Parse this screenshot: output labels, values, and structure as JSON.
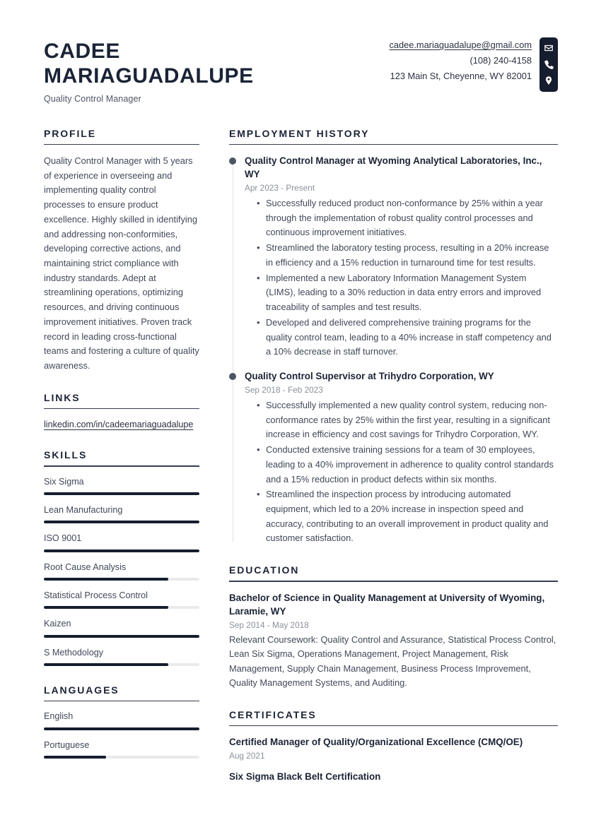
{
  "header": {
    "name_line_1": "CADEE",
    "name_line_2": "MARIAGUADALUPE",
    "job_title": "Quality Control Manager",
    "contact": {
      "email": "cadee.mariaguadalupe@gmail.com",
      "phone": "(108) 240-4158",
      "address": "123 Main St, Cheyenne, WY 82001",
      "icons": [
        "envelope-icon",
        "phone-icon",
        "location-pin-icon"
      ]
    }
  },
  "sections": {
    "profile": {
      "title": "PROFILE",
      "text": "Quality Control Manager with 5 years of experience in overseeing and implementing quality control processes to ensure product excellence. Highly skilled in identifying and addressing non-conformities, developing corrective actions, and maintaining strict compliance with industry standards. Adept at streamlining operations, optimizing resources, and driving continuous improvement initiatives. Proven track record in leading cross-functional teams and fostering a culture of quality awareness."
    },
    "links": {
      "title": "LINKS",
      "items": [
        {
          "label": "linkedin.com/in/cadeemariaguadalupe"
        }
      ]
    },
    "skills": {
      "title": "SKILLS",
      "items": [
        {
          "label": "Six Sigma",
          "level": 100
        },
        {
          "label": "Lean Manufacturing",
          "level": 100
        },
        {
          "label": "ISO 9001",
          "level": 100
        },
        {
          "label": "Root Cause Analysis",
          "level": 80
        },
        {
          "label": "Statistical Process Control",
          "level": 80
        },
        {
          "label": "Kaizen",
          "level": 100
        },
        {
          "label": "S Methodology",
          "level": 80
        }
      ]
    },
    "languages": {
      "title": "LANGUAGES",
      "items": [
        {
          "label": "English",
          "level": 100
        },
        {
          "label": "Portuguese",
          "level": 40
        }
      ]
    },
    "employment": {
      "title": "EMPLOYMENT HISTORY",
      "entries": [
        {
          "title": "Quality Control Manager at Wyoming Analytical Laboratories, Inc., WY",
          "date": "Apr 2023 - Present",
          "bullets": [
            "Successfully reduced product non-conformance by 25% within a year through the implementation of robust quality control processes and continuous improvement initiatives.",
            "Streamlined the laboratory testing process, resulting in a 20% increase in efficiency and a 15% reduction in turnaround time for test results.",
            "Implemented a new Laboratory Information Management System (LIMS), leading to a 30% reduction in data entry errors and improved traceability of samples and test results.",
            "Developed and delivered comprehensive training programs for the quality control team, leading to a 40% increase in staff competency and a 10% decrease in staff turnover."
          ]
        },
        {
          "title": "Quality Control Supervisor at Trihydro Corporation, WY",
          "date": "Sep 2018 - Feb 2023",
          "bullets": [
            "Successfully implemented a new quality control system, reducing non-conformance rates by 25% within the first year, resulting in a significant increase in efficiency and cost savings for Trihydro Corporation, WY.",
            "Conducted extensive training sessions for a team of 30 employees, leading to a 40% improvement in adherence to quality control standards and a 15% reduction in product defects within six months.",
            "Streamlined the inspection process by introducing automated equipment, which led to a 20% increase in inspection speed and accuracy, contributing to an overall improvement in product quality and customer satisfaction."
          ]
        }
      ]
    },
    "education": {
      "title": "EDUCATION",
      "entries": [
        {
          "title": "Bachelor of Science in Quality Management at University of Wyoming, Laramie, WY",
          "date": "Sep 2014 - May 2018",
          "desc": "Relevant Coursework: Quality Control and Assurance, Statistical Process Control, Lean Six Sigma, Operations Management, Project Management, Risk Management, Supply Chain Management, Business Process Improvement, Quality Management Systems, and Auditing."
        }
      ]
    },
    "certificates": {
      "title": "CERTIFICATES",
      "entries": [
        {
          "title": "Certified Manager of Quality/Organizational Excellence (CMQ/OE)",
          "date": "Aug 2021"
        },
        {
          "title": "Six Sigma Black Belt Certification",
          "date": ""
        }
      ]
    }
  },
  "theme": {
    "ink": "#1b2436",
    "body": "#414859",
    "muted": "#8b9199",
    "accent_dark": "#161d2e",
    "track": "#e8eaec",
    "timeline": "#dfe1e5",
    "dot": "#4c5465"
  }
}
